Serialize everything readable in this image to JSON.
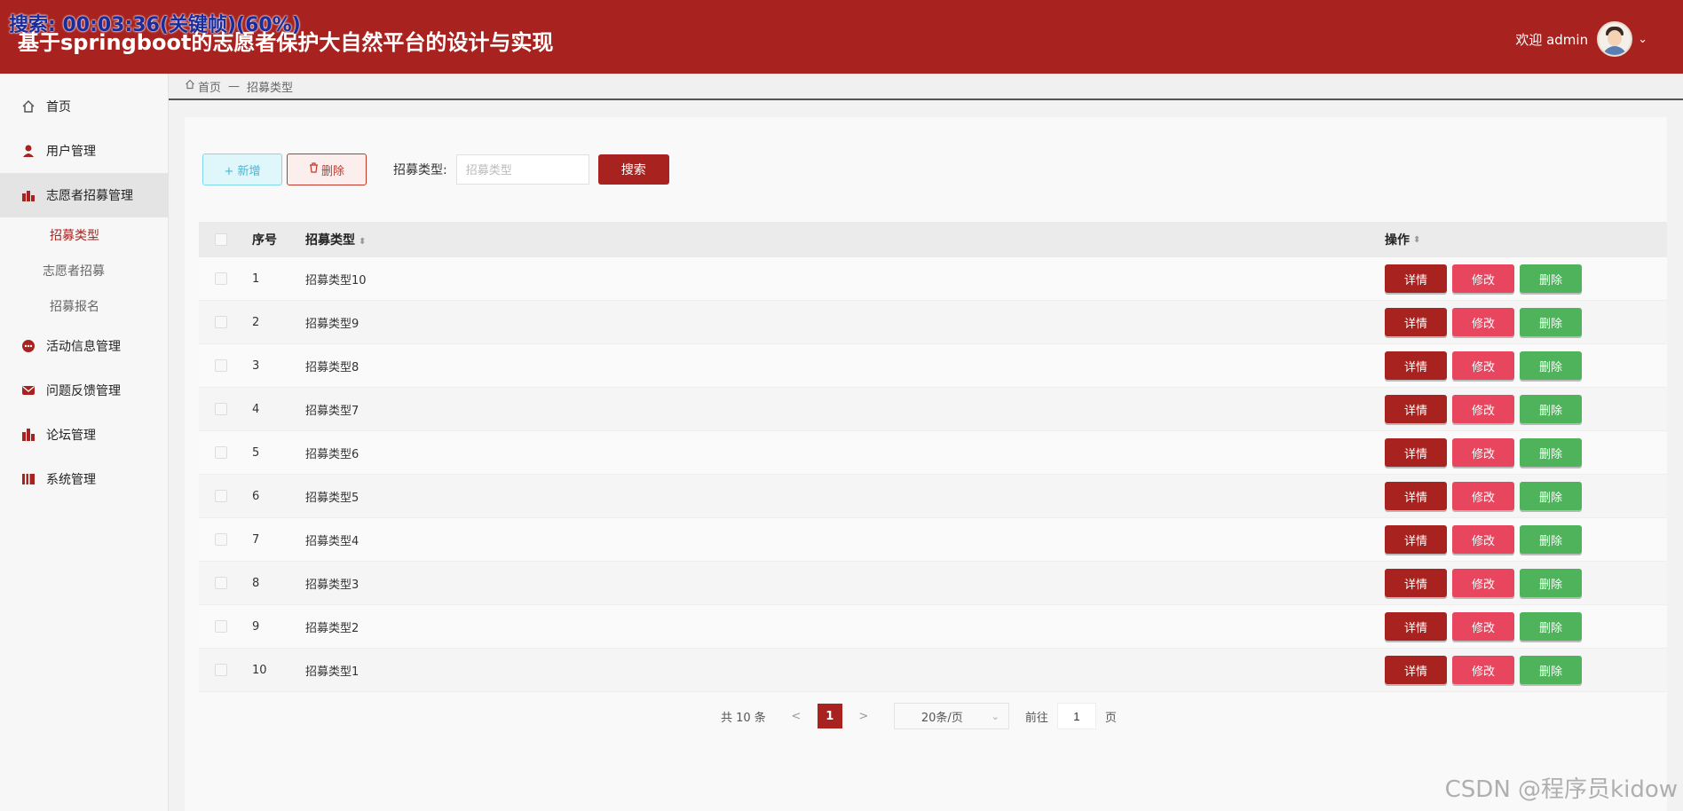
{
  "overlay": {
    "video_status": "搜索: 00:03:36(关键帧)(60%)"
  },
  "header": {
    "title": "基于springboot的志愿者保护大自然平台的设计与实现",
    "welcome": "欢迎 admin",
    "caret": "⌄"
  },
  "sidebar": {
    "items": [
      {
        "label": "首页",
        "icon": "home-icon"
      },
      {
        "label": "用户管理",
        "icon": "user-icon"
      },
      {
        "label": "志愿者招募管理",
        "icon": "chart-icon"
      },
      {
        "label": "活动信息管理",
        "icon": "chat-icon"
      },
      {
        "label": "问题反馈管理",
        "icon": "mail-icon"
      },
      {
        "label": "论坛管理",
        "icon": "forum-icon"
      },
      {
        "label": "系统管理",
        "icon": "book-icon"
      }
    ],
    "sub_items": [
      {
        "label": "招募类型"
      },
      {
        "label": "志愿者招募"
      },
      {
        "label": "招募报名"
      }
    ]
  },
  "breadcrumb": {
    "home": "首页",
    "separator": "—",
    "current": "招募类型"
  },
  "toolbar": {
    "add_label": "+ 新增",
    "delete_label": "删除",
    "search_label": "招募类型:",
    "search_placeholder": "招募类型",
    "search_button": "搜索"
  },
  "table": {
    "headers": {
      "index": "序号",
      "type": "招募类型",
      "ops": "操作"
    },
    "rows": [
      {
        "index": "1",
        "type": "招募类型10"
      },
      {
        "index": "2",
        "type": "招募类型9"
      },
      {
        "index": "3",
        "type": "招募类型8"
      },
      {
        "index": "4",
        "type": "招募类型7"
      },
      {
        "index": "5",
        "type": "招募类型6"
      },
      {
        "index": "6",
        "type": "招募类型5"
      },
      {
        "index": "7",
        "type": "招募类型4"
      },
      {
        "index": "8",
        "type": "招募类型3"
      },
      {
        "index": "9",
        "type": "招募类型2"
      },
      {
        "index": "10",
        "type": "招募类型1"
      }
    ],
    "op_detail": "详情",
    "op_edit": "修改",
    "op_delete": "删除"
  },
  "pagination": {
    "total": "共 10 条",
    "prev": "<",
    "current": "1",
    "next": ">",
    "page_size": "20条/页",
    "goto_label": "前往",
    "goto_value": "1",
    "goto_suffix": "页"
  },
  "watermark": "CSDN @程序员kidow",
  "colors": {
    "brand": "#a8231f",
    "edit": "#e8465e",
    "delete": "#4eb35a"
  }
}
